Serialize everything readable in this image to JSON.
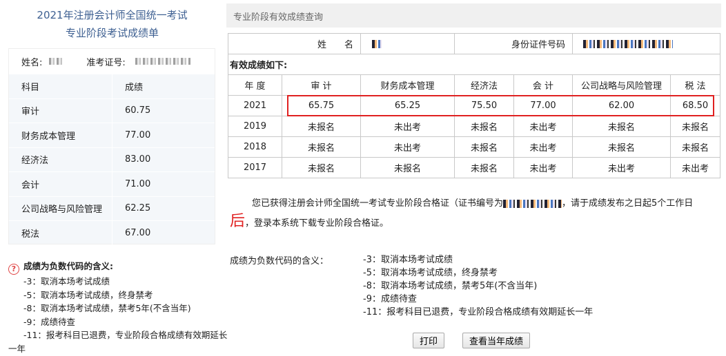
{
  "left": {
    "title1": "2021年注册会计师全国统一考试",
    "title2": "专业阶段考试成绩单",
    "name_label": "姓名:",
    "ticket_label": "准考证号:",
    "col_subject": "科目",
    "col_score": "成绩",
    "rows": [
      [
        "审计",
        "60.75"
      ],
      [
        "财务成本管理",
        "77.00"
      ],
      [
        "经济法",
        "83.00"
      ],
      [
        "会计",
        "71.00"
      ],
      [
        "公司战略与风险管理",
        "62.25"
      ],
      [
        "税法",
        "67.00"
      ]
    ],
    "legend_title": "成绩为负数代码的含义:",
    "legend": [
      "-3：取消本场考试成绩",
      "-5：取消本场考试成绩，终身禁考",
      "-8：取消本场考试成绩，禁考5年(不含当年)",
      "-9：成绩待查",
      "-11：报考科目已退费，专业阶段合格成绩有效期延长一年"
    ]
  },
  "right": {
    "header": "专业阶段有效成绩查询",
    "name_label": "姓　　名",
    "id_label": "身份证件号码",
    "valid_label": "有效成绩如下:",
    "columns": [
      "年 度",
      "审 计",
      "财务成本管理",
      "经济法",
      "会 计",
      "公司战略与风险管理",
      "税 法"
    ],
    "rows": [
      [
        "2021",
        "65.75",
        "65.25",
        "75.50",
        "77.00",
        "62.00",
        "68.50"
      ],
      [
        "2019",
        "未报名",
        "未出考",
        "未报名",
        "未出考",
        "未报名",
        "未报名"
      ],
      [
        "2018",
        "未报名",
        "未出考",
        "未报名",
        "未出考",
        "未报名",
        "未报名"
      ],
      [
        "2017",
        "未报名",
        "未报名",
        "未报名",
        "未出考",
        "未出考",
        "未出考"
      ]
    ],
    "para1": "您已获得注册会计师全国统一考试专业阶段合格证（证书编号为",
    "para2": "，请于成绩发布之日起5个工作日",
    "para_big": "后",
    "para3": "，登录本系统下载专业阶段合格证。",
    "neg_title": "成绩为负数代码的含义：",
    "neg": [
      "-3：取消本场考试成绩",
      "-5：取消本场考试成绩，终身禁考",
      "-8：取消本场考试成绩，禁考5年(不含当年)",
      "-9：成绩待查",
      "-11：报考科目已退费，专业阶段合格成绩有效期延长一年"
    ],
    "print": "打印",
    "view": "查看当年成绩"
  }
}
